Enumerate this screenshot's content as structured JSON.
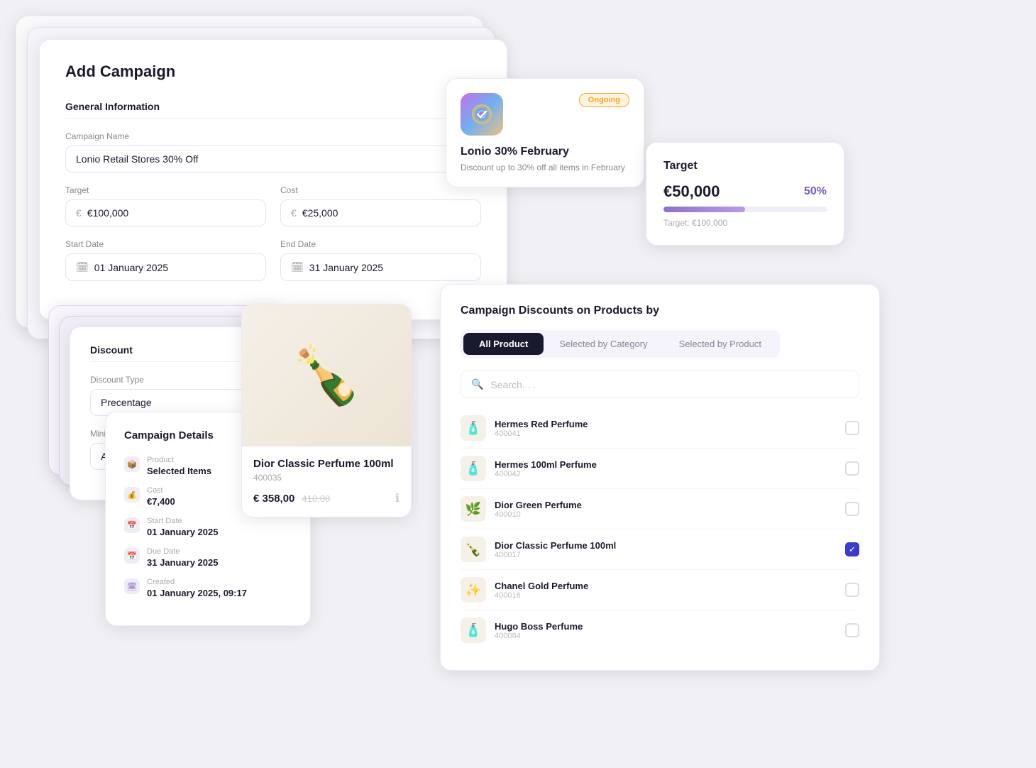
{
  "addCampaign": {
    "title": "Add Campaign",
    "generalInfo": {
      "sectionTitle": "General Information",
      "campaignNameLabel": "Campaign Name",
      "campaignNameValue": "Lonio Retail Stores 30% Off",
      "targetLabel": "Target",
      "targetValue": "€100,000",
      "costLabel": "Cost",
      "costValue": "€25,000",
      "startDateLabel": "Start Date",
      "startDateValue": "01 January 2025",
      "endDateLabel": "End Date",
      "endDateValue": "31 January 2025"
    }
  },
  "discount": {
    "sectionTitle": "Discount",
    "discountTypeLabel": "Discount Type",
    "discountTypeValue": "Precentage",
    "minPurchaseLabel": "Minimum Purchase",
    "minPurchaseValue": "Amount"
  },
  "campaignDetails": {
    "title": "Campaign Details",
    "items": [
      {
        "icon": "📦",
        "label": "Product",
        "value": "Selected Items"
      },
      {
        "icon": "💰",
        "label": "Cost",
        "value": "€7,400"
      },
      {
        "icon": "📅",
        "label": "Start Date",
        "value": "01 January 2025"
      },
      {
        "icon": "📅",
        "label": "Due Date",
        "value": "31 January 2025"
      },
      {
        "icon": "🗓",
        "label": "Created",
        "value": "01 January 2025, 09:17"
      }
    ]
  },
  "product": {
    "name": "Dior Classic Perfume 100ml",
    "sku": "400035",
    "priceNew": "€ 358,00",
    "priceOld": "410,00"
  },
  "ongoing": {
    "badge": "Ongoing",
    "title": "Lonio 30% February",
    "description": "Discount up to 30% off all items in February"
  },
  "target": {
    "title": "Target",
    "amount": "€50,000",
    "percent": "50%",
    "progressWidth": "50%",
    "targetLabel": "Target: €100,000"
  },
  "productsPanel": {
    "title": "Campaign Discounts on Products by",
    "tabs": [
      {
        "label": "All Product",
        "active": true
      },
      {
        "label": "Selected by Category",
        "active": false
      },
      {
        "label": "Selected by Product",
        "active": false
      }
    ],
    "searchPlaceholder": "Search. . .",
    "products": [
      {
        "name": "Hermes  Red Perfume",
        "code": "400041",
        "checked": false
      },
      {
        "name": "Hermes 100ml Perfume",
        "code": "400042",
        "checked": false
      },
      {
        "name": "Dior  Green Perfume",
        "code": "400010",
        "checked": false
      },
      {
        "name": "Dior Classic Perfume 100ml",
        "code": "400017",
        "checked": true
      },
      {
        "name": "Chanel Gold Perfume",
        "code": "400016",
        "checked": false
      },
      {
        "name": "Hugo Boss Perfume",
        "code": "400084",
        "checked": false
      }
    ]
  }
}
